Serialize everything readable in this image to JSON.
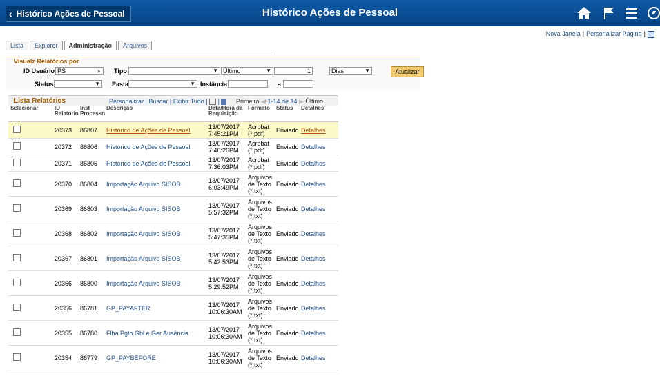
{
  "header": {
    "back_label": "Histórico Ações de Pessoal",
    "title": "Histórico Ações de Pessoal"
  },
  "toplinks": {
    "new_window": "Nova Janela",
    "personalize": "Personalizar Página"
  },
  "tabs": [
    "Lista",
    "Explorer",
    "Administração",
    "Arquivos"
  ],
  "filter": {
    "title": "Visualz Relatórios por",
    "user_label": "ID Usuário",
    "user_value": "PS",
    "type_label": "Tipo",
    "type_value": "",
    "period_value": "Último",
    "period_num": "1",
    "period_unit": "Dias",
    "refresh": "Atualizar",
    "status_label": "Status",
    "status_value": "",
    "folder_label": "Pasta",
    "folder_value": "",
    "instance_label": "Instância",
    "to_label": "a"
  },
  "grid": {
    "title": "Lista Relatórios",
    "link_personalize": "Personalizar",
    "link_search": "Buscar",
    "link_all": "Exibir Tudo",
    "first": "Primeiro",
    "range": "1-14 de 14",
    "last": "Último",
    "columns": [
      "Selecionar",
      "ID Relatório",
      "Inst Processo",
      "Descrição",
      "Data/Hora da Requisição",
      "Formato",
      "Status",
      "Detalhes"
    ],
    "rows": [
      {
        "id": "20373",
        "inst": "86807",
        "desc": "Histórico de Ações de Pessoal",
        "date": "13/07/2017 7:45:21PM",
        "fmt": "Acrobat (*.pdf)",
        "status": "Enviado",
        "det": "Detalhes",
        "hl": true
      },
      {
        "id": "20372",
        "inst": "86806",
        "desc": "Histórico de Ações de Pessoal",
        "date": "13/07/2017 7:40:26PM",
        "fmt": "Acrobat (*.pdf)",
        "status": "Enviado",
        "det": "Detalhes"
      },
      {
        "id": "20371",
        "inst": "86805",
        "desc": "Histórico de Ações de Pessoal",
        "date": "13/07/2017 7:36:03PM",
        "fmt": "Acrobat (*.pdf)",
        "status": "Enviado",
        "det": "Detalhes"
      },
      {
        "id": "20370",
        "inst": "86804",
        "desc": "Importação Arquivo SISOB",
        "date": "13/07/2017 6:03:49PM",
        "fmt": "Arquivos de Texto (*.txt)",
        "status": "Enviado",
        "det": "Detalhes"
      },
      {
        "id": "20369",
        "inst": "86803",
        "desc": "Importação Arquivo SISOB",
        "date": "13/07/2017 5:57:32PM",
        "fmt": "Arquivos de Texto (*.txt)",
        "status": "Enviado",
        "det": "Detalhes"
      },
      {
        "id": "20368",
        "inst": "86802",
        "desc": "Importação Arquivo SISOB",
        "date": "13/07/2017 5:47:35PM",
        "fmt": "Arquivos de Texto (*.txt)",
        "status": "Enviado",
        "det": "Detalhes"
      },
      {
        "id": "20367",
        "inst": "86801",
        "desc": "Importação Arquivo SISOB",
        "date": "13/07/2017 5:42:53PM",
        "fmt": "Arquivos de Texto (*.txt)",
        "status": "Enviado",
        "det": "Detalhes"
      },
      {
        "id": "20366",
        "inst": "86800",
        "desc": "Importação Arquivo SISOB",
        "date": "13/07/2017 5:29:52PM",
        "fmt": "Arquivos de Texto (*.txt)",
        "status": "Enviado",
        "det": "Detalhes"
      },
      {
        "id": "20356",
        "inst": "86781",
        "desc": "GP_PAYAFTER",
        "date": "13/07/2017 10:06:30AM",
        "fmt": "Arquivos de Texto (*.txt)",
        "status": "Enviado",
        "det": "Detalhes"
      },
      {
        "id": "20355",
        "inst": "86780",
        "desc": "Flha Pgto Gbl e Ger Ausência",
        "date": "13/07/2017 10:06:30AM",
        "fmt": "Arquivos de Texto (*.txt)",
        "status": "Enviado",
        "det": "Detalhes"
      },
      {
        "id": "20354",
        "inst": "86779",
        "desc": "GP_PAYBEFORE",
        "date": "13/07/2017 10:06:30AM",
        "fmt": "Arquivos de Texto (*.txt)",
        "status": "Enviado",
        "det": "Detalhes"
      }
    ]
  }
}
